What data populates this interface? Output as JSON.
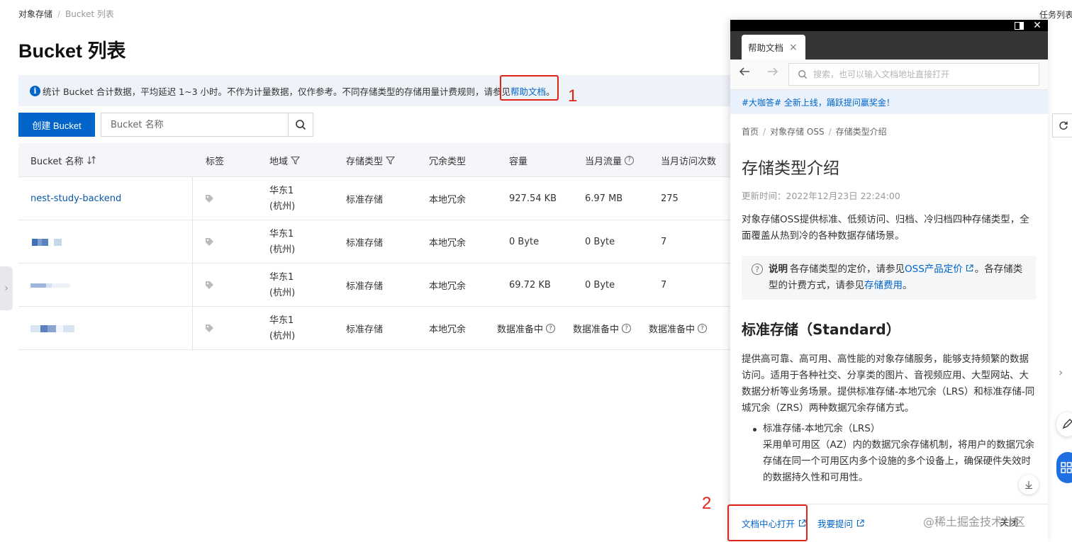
{
  "breadcrumb": {
    "root": "对象存储",
    "sep": "/",
    "current": "Bucket 列表"
  },
  "task_list": "任务列表",
  "page_title": "Bucket 列表",
  "notice": {
    "text": "统计 Bucket 合计数据，平均延迟 1~3 小时。不作为计量数据，仅作参考。不同存储类型的存储用量计费规则，请参见",
    "link": "帮助文档",
    "tail": "。"
  },
  "annotations": {
    "one": "1",
    "two": "2"
  },
  "toolbar": {
    "create_label": "创建 Bucket",
    "search_placeholder": "Bucket 名称"
  },
  "table": {
    "headers": {
      "name": "Bucket 名称",
      "tags": "标签",
      "region": "地域",
      "storage": "存储类型",
      "redundancy": "冗余类型",
      "capacity": "容量",
      "traffic": "当月流量",
      "visits": "当月访问次数"
    },
    "rows": [
      {
        "name": "nest-study-backend",
        "region1": "华东1",
        "region2": "(杭州)",
        "storage": "标准存储",
        "redundancy": "本地冗余",
        "capacity": "927.54 KB",
        "traffic": "6.97 MB",
        "visits": "275"
      },
      {
        "name": "",
        "region1": "华东1",
        "region2": "(杭州)",
        "storage": "标准存储",
        "redundancy": "本地冗余",
        "capacity": "0 Byte",
        "traffic": "0 Byte",
        "visits": "7"
      },
      {
        "name": "",
        "region1": "华东1",
        "region2": "(杭州)",
        "storage": "标准存储",
        "redundancy": "本地冗余",
        "capacity": "69.72 KB",
        "traffic": "0 Byte",
        "visits": "7"
      },
      {
        "name": "",
        "region1": "华东1",
        "region2": "(杭州)",
        "storage": "标准存储",
        "redundancy": "本地冗余",
        "capacity": "数据准备中",
        "traffic": "数据准备中",
        "visits": "数据准备中"
      }
    ]
  },
  "help_panel": {
    "tab_label": "帮助文档",
    "search_placeholder": "搜索，也可以输入文档地址直接打开",
    "promo": "#大咖答# 全新上线，踊跃提问赢奖金！",
    "crumbs": [
      "首页",
      "对象存储 OSS",
      "存储类型介绍"
    ],
    "crumb_sep": "/",
    "title": "存储类型介绍",
    "updated": "更新时间：2022年12月23日 22:24:00",
    "intro": "对象存储OSS提供标准、低频访问、归档、冷归档四种存储类型，全面覆盖从热到冷的各种数据存储场景。",
    "note": {
      "label": "说明",
      "text1": "各存储类型的定价，请参见",
      "link1": "OSS产品定价",
      "text2": "。各存储类型的计费方式，请参见",
      "link2": "存储费用",
      "text3": "。"
    },
    "h2": "标准存储（Standard）",
    "standard_p": "提供高可靠、高可用、高性能的对象存储服务，能够支持频繁的数据访问。适用于各种社交、分享类的图片、音视频应用、大型网站、大数据分析等业务场景。提供标准存储-本地冗余（LRS）和标准存储-同城冗余（ZRS）两种数据冗余存储方式。",
    "bullet_title": "标准存储-本地冗余（LRS）",
    "bullet_desc": "采用单可用区（AZ）内的数据冗余存储机制，将用户的数据冗余存储在同一个可用区内多个设施的多个设备上，确保硬件失效时的数据持久性和可用性。",
    "footer": {
      "open_center": "文档中心打开",
      "ask": "我要提问",
      "close": "关闭"
    }
  },
  "watermark": "@稀土掘金技术社区",
  "colors": {
    "primary": "#0064c8",
    "annotation": "#e2231a",
    "panel_header": "#353535"
  }
}
